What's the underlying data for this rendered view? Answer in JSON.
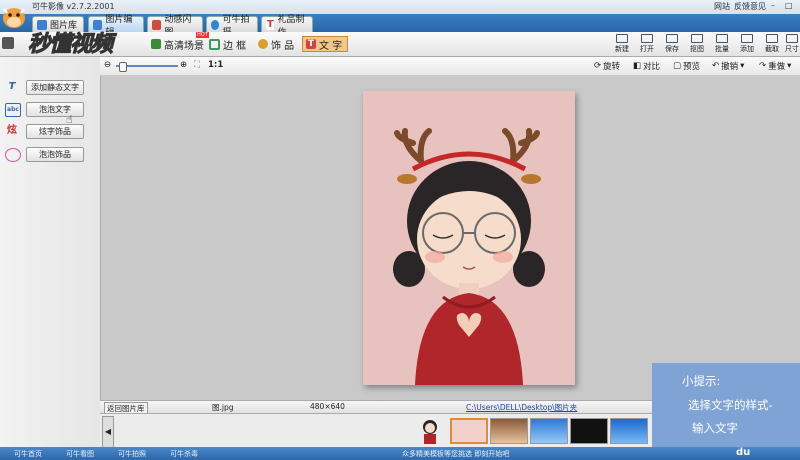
{
  "app": {
    "title": "可牛影像 v2.7.2.2001",
    "title_links": [
      "网站",
      "反馈意见"
    ],
    "window_controls": [
      "minimize-icon",
      "maximize-icon",
      "close-icon"
    ]
  },
  "tabs": [
    {
      "label": "图片库",
      "icon_color": "#3d7fd1"
    },
    {
      "label": "图片编辑",
      "icon_color": "#3d7fd1",
      "active": true
    },
    {
      "label": "动感闪图",
      "icon_color": "#d14a3d"
    },
    {
      "label": "可牛拍摄",
      "icon_color": "#2a88d8"
    },
    {
      "label": "礼品制作",
      "icon_color": "#d13d3d"
    }
  ],
  "toolbar": {
    "tools": [
      {
        "label": "高清场景",
        "badge": "HOT"
      },
      {
        "label": "边 框"
      },
      {
        "label": "饰 品"
      },
      {
        "label": "文 字",
        "active": true
      }
    ],
    "right": [
      "新建",
      "打开",
      "保存",
      "抠图",
      "批量",
      "添加",
      "截取",
      "尺寸"
    ]
  },
  "watermark": "秒懂视频",
  "subbar": {
    "zoom_label": "1:1",
    "zoom_level": 0.05,
    "actions": [
      "旋转",
      "对比",
      "预览",
      "撤销",
      "重做"
    ]
  },
  "left_panel": {
    "items": [
      {
        "label": "添加静态文字",
        "icon": "text-T-icon"
      },
      {
        "label": "泡泡文字",
        "icon": "bubble-text-icon"
      },
      {
        "label": "炫字饰品",
        "icon": "fancy-text-icon"
      },
      {
        "label": "泡泡饰品",
        "icon": "bubble-decoration-icon"
      }
    ]
  },
  "status": {
    "back_button": "返回图片库",
    "filename": "图.jpg",
    "dimensions": "480×640",
    "path": "C:\\Users\\DELL\\Desktop\\图片夹"
  },
  "tip": {
    "title": "小提示:",
    "line1": "选择文字的样式-",
    "line2": "输入文字"
  },
  "taskbar": {
    "items": [
      "可牛首页",
      "可牛看图",
      "可牛拍照",
      "可牛杀毒"
    ],
    "center_text": "众多精美模板等您挑选 即刻开始吧",
    "brand": "du"
  },
  "colors": {
    "tab_bar": "#2f6fb4",
    "active_tool": "#f2c88a",
    "tip_bg": "#7ea3d4",
    "photo_bg": "#e8c2be"
  }
}
